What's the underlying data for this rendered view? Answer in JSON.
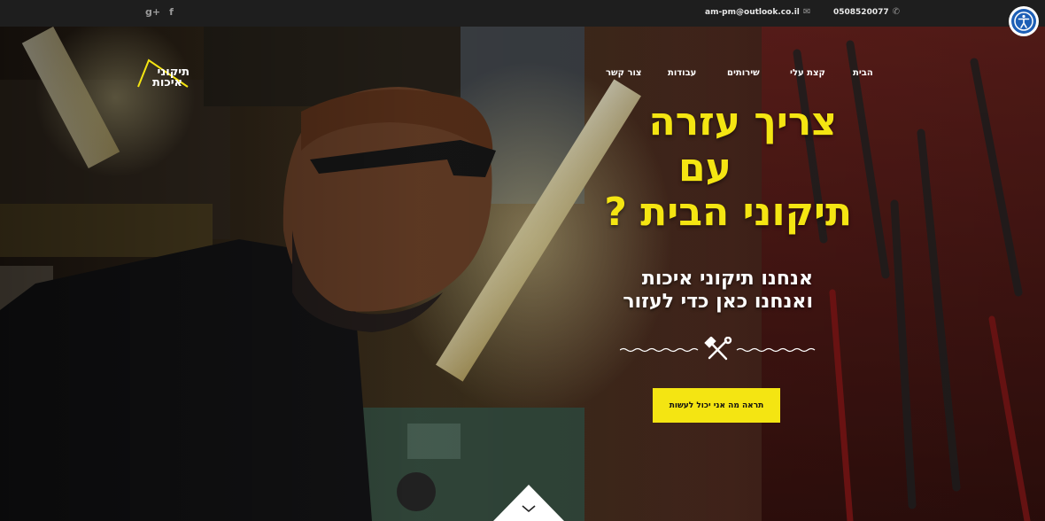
{
  "topbar": {
    "social": [
      "g+",
      "f"
    ],
    "email": "am-pm@outlook.co.il",
    "phone": "0508520077"
  },
  "logo": {
    "line1": "תיקוני",
    "line2": "איכות"
  },
  "nav": {
    "items": [
      "הבית",
      "קצת עלי",
      "שירותים",
      "עבודות",
      "צור קשר"
    ]
  },
  "hero": {
    "headline": [
      "צריך עזרה",
      "עם",
      "תיקוני הבית ?"
    ],
    "subline": [
      "אנחנו תיקוני איכות",
      "ואנחנו כאן כדי לעזור"
    ],
    "cta_label": "תראה מה אני יכול לעשות"
  },
  "icons": {
    "google_plus": "google-plus-icon",
    "facebook": "facebook-icon",
    "mail": "mail-icon",
    "phone": "phone-icon",
    "tools": "hammer-wrench-icon",
    "down": "chevron-down-icon",
    "accessibility": "accessibility-icon"
  },
  "colors": {
    "accent": "#f4e512",
    "topbar": "#1e1e1e",
    "access_blue": "#1d5fb6"
  }
}
